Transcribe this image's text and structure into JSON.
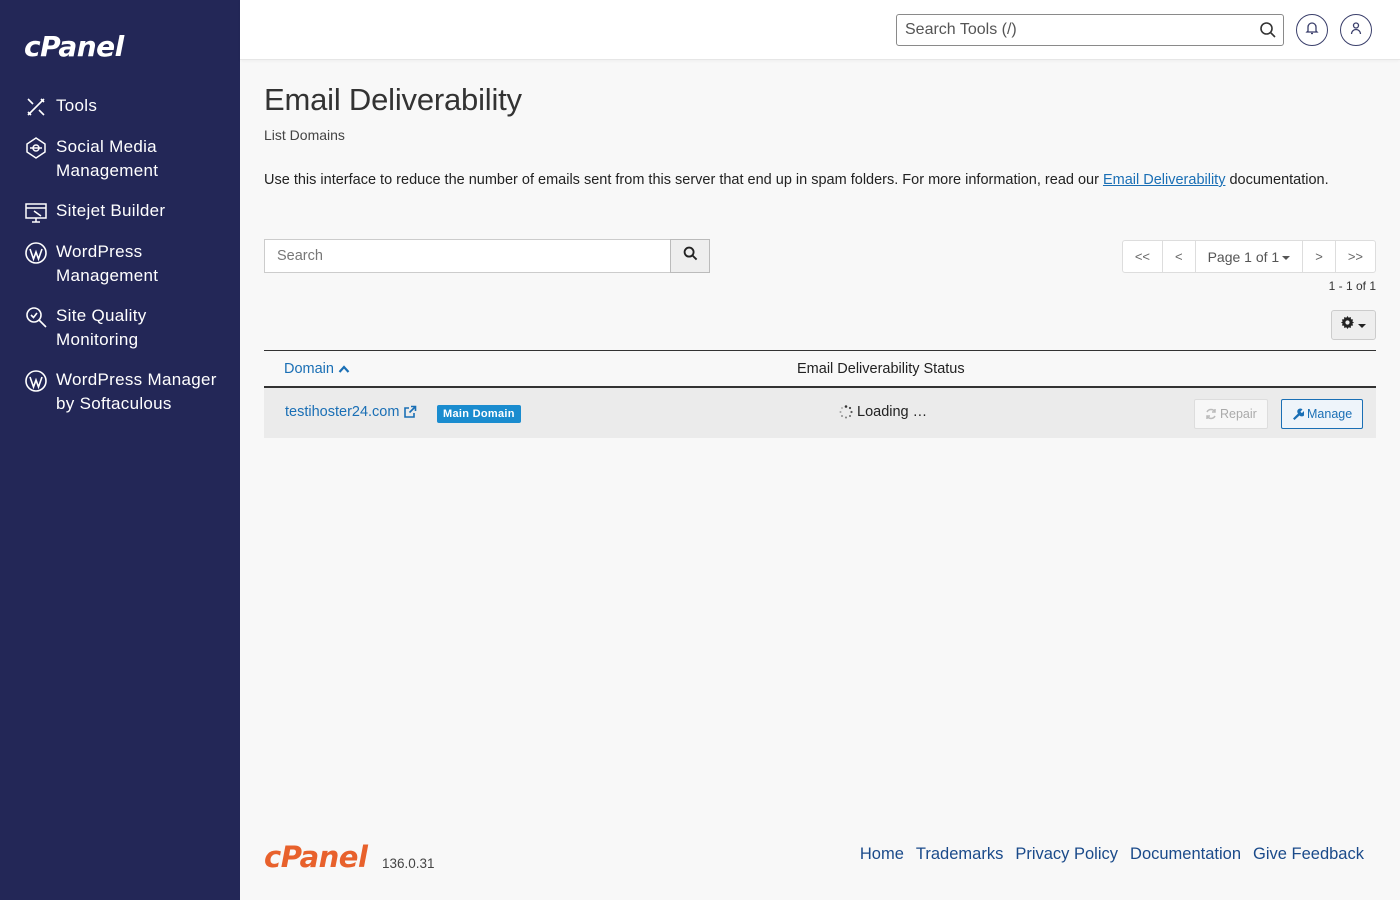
{
  "sidebar": {
    "logo": "cPanel",
    "items": [
      {
        "label": "Tools",
        "icon": "tools-icon"
      },
      {
        "label": "Social Media Management",
        "icon": "social-media-icon"
      },
      {
        "label": "Sitejet Builder",
        "icon": "sitejet-icon"
      },
      {
        "label": "WordPress Management",
        "icon": "wordpress-icon"
      },
      {
        "label": "Site Quality Monitoring",
        "icon": "site-quality-icon"
      },
      {
        "label": "WordPress Manager by Softaculous",
        "icon": "wordpress-icon"
      }
    ]
  },
  "topbar": {
    "search_placeholder": "Search Tools (/)"
  },
  "main": {
    "title": "Email Deliverability",
    "subtitle": "List Domains",
    "description_prefix": "Use this interface to reduce the number of emails sent from this server that end up in spam folders. For more information, read our ",
    "description_link": "Email Deliverability",
    "description_suffix": " documentation.",
    "search_placeholder": "Search",
    "pager": {
      "first": "<<",
      "prev": "<",
      "page_label": "Page 1 of 1",
      "next": ">",
      "last": ">>"
    },
    "range_text": "1 - 1 of 1"
  },
  "table": {
    "columns": [
      "Domain",
      "Email Deliverability Status"
    ],
    "rows": [
      {
        "domain": "testihoster24.com",
        "badge": "Main Domain",
        "status": "Loading …",
        "repair_label": "Repair",
        "manage_label": "Manage"
      }
    ]
  },
  "footer": {
    "logo": "cPanel",
    "version": "136.0.31",
    "links": [
      "Home",
      "Trademarks",
      "Privacy Policy",
      "Documentation",
      "Give Feedback"
    ]
  },
  "colors": {
    "sidebar_bg": "#232757",
    "link": "#1a6fb5",
    "badge": "#1a8ccf",
    "footer_logo": "#e8612c"
  }
}
